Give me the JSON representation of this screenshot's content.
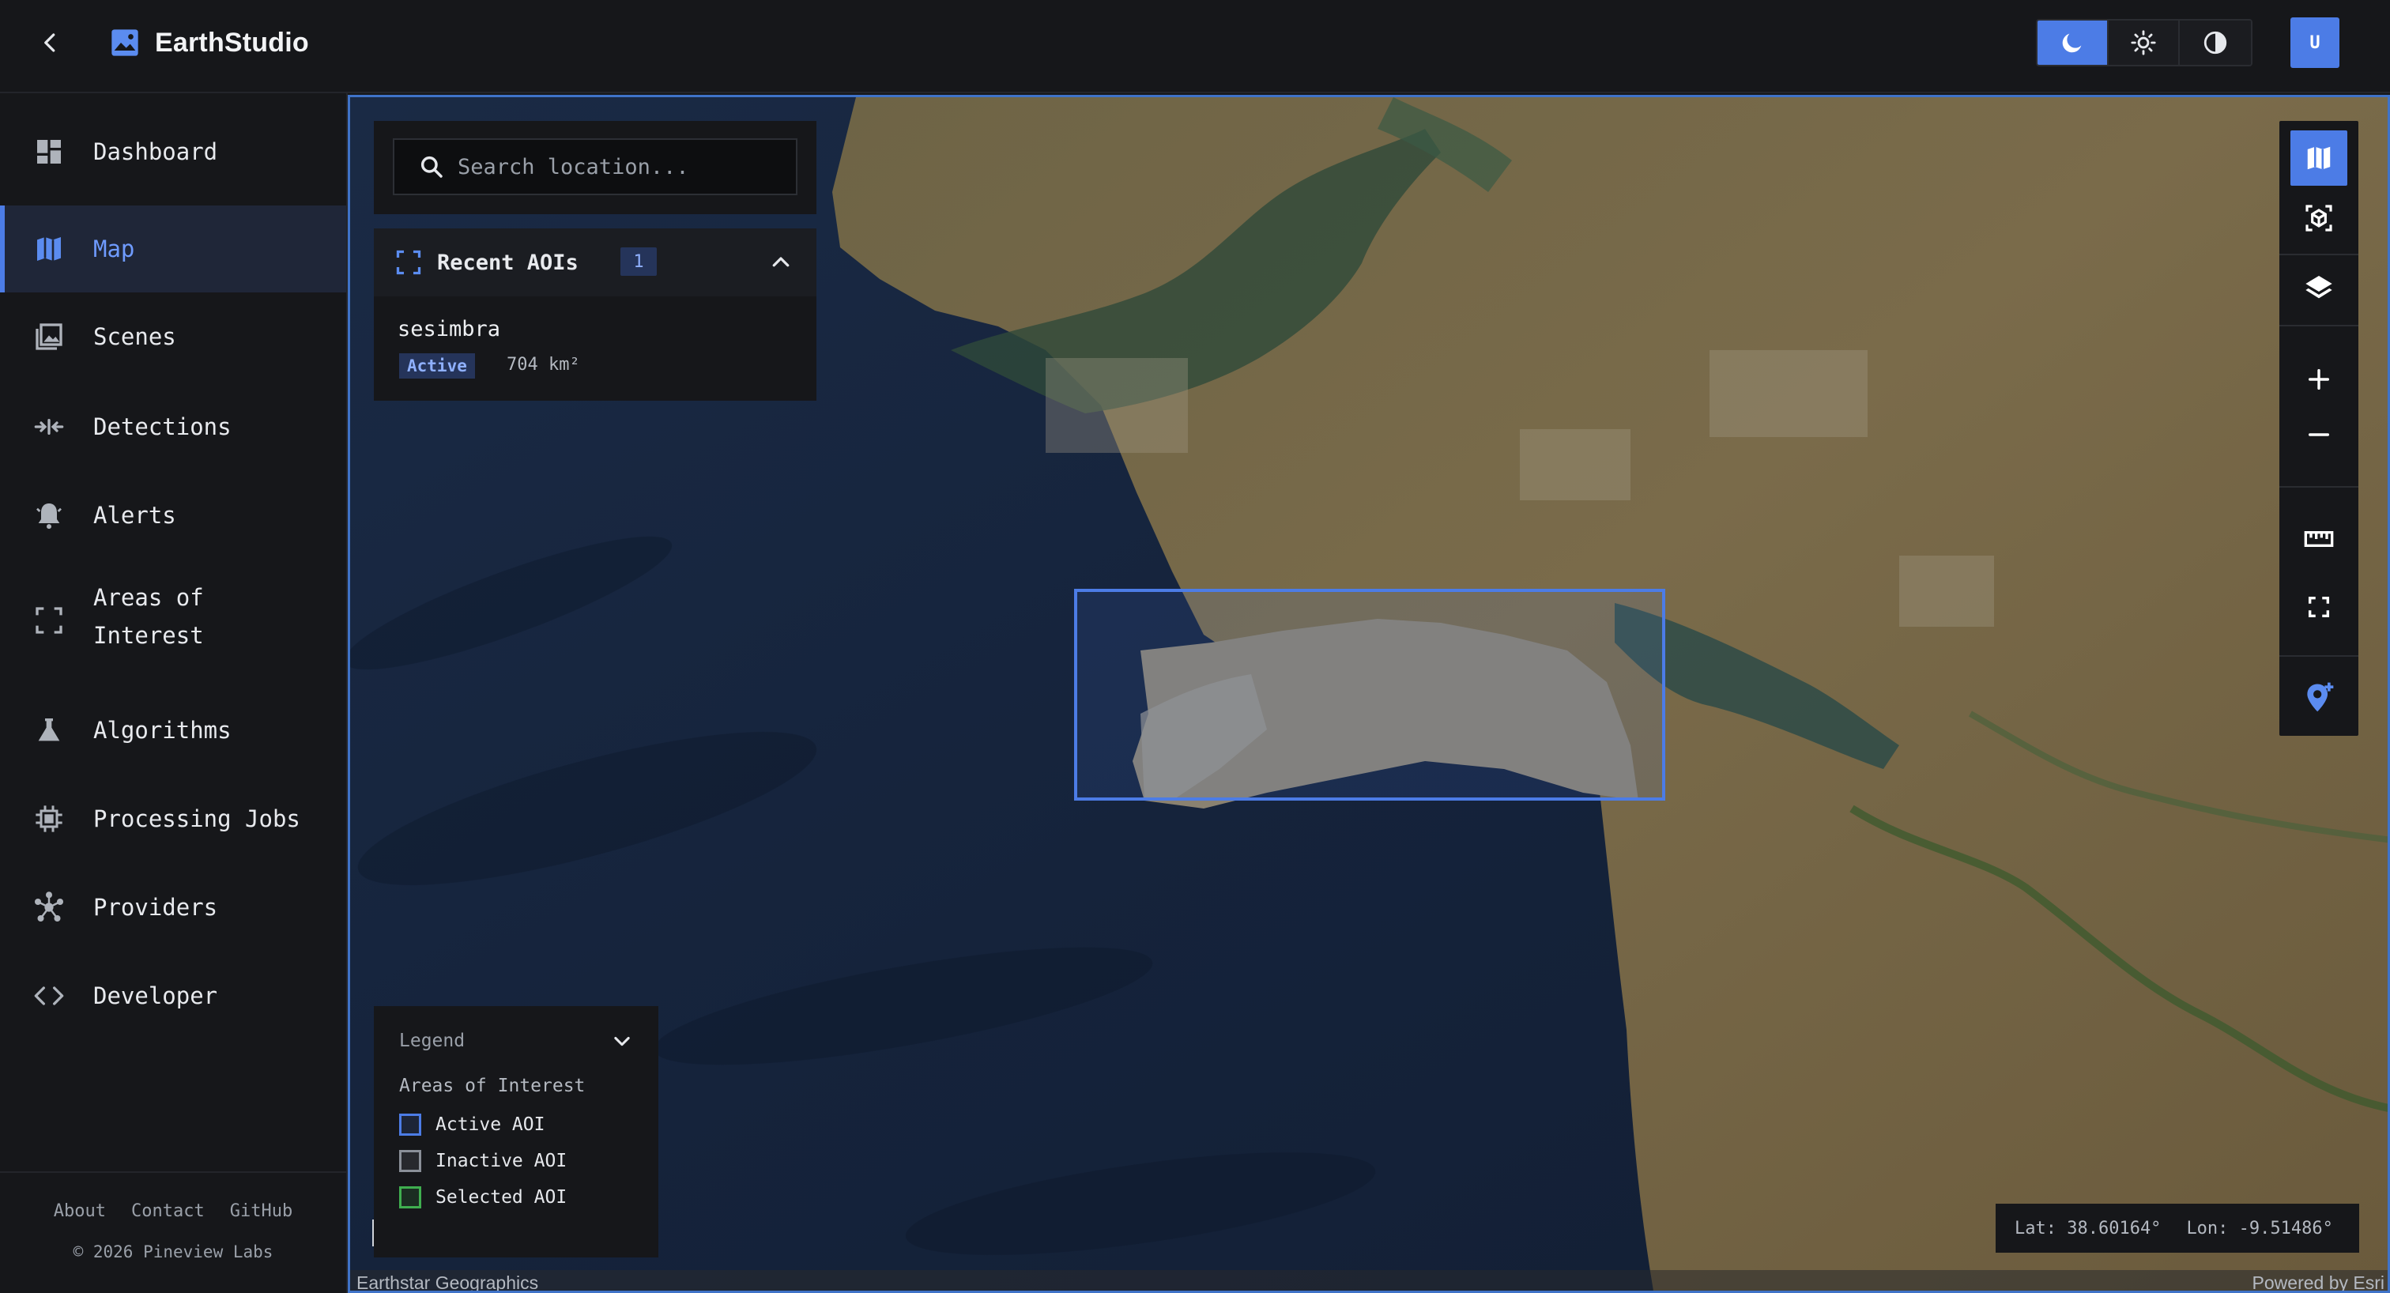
{
  "app": {
    "name": "EarthStudio"
  },
  "header": {
    "back_label": "Back",
    "theme_modes": [
      {
        "name": "dark",
        "icon": "moon-icon",
        "active": true
      },
      {
        "name": "light",
        "icon": "sun-icon",
        "active": false
      },
      {
        "name": "contrast",
        "icon": "contrast-icon",
        "active": false
      }
    ],
    "user_initial": "U"
  },
  "sidebar": {
    "items": [
      {
        "label": "Dashboard",
        "icon": "dashboard-icon",
        "active": false
      },
      {
        "label": "Map",
        "icon": "map-icon",
        "active": true
      },
      {
        "label": "Scenes",
        "icon": "scenes-icon",
        "active": false
      },
      {
        "label": "Detections",
        "icon": "detections-icon",
        "active": false
      },
      {
        "label": "Alerts",
        "icon": "alerts-icon",
        "active": false
      },
      {
        "label": "Areas of",
        "label2": "Interest",
        "icon": "aoi-icon",
        "active": false
      },
      {
        "label": "Algorithms",
        "icon": "algorithms-icon",
        "active": false
      },
      {
        "label": "Processing Jobs",
        "icon": "processing-icon",
        "active": false
      },
      {
        "label": "Providers",
        "icon": "providers-icon",
        "active": false
      },
      {
        "label": "Developer",
        "icon": "code-icon",
        "active": false
      }
    ],
    "footer": {
      "links": [
        "About",
        "Contact",
        "GitHub"
      ],
      "copyright": "© 2026 Pineview Labs"
    }
  },
  "map": {
    "search": {
      "placeholder": "Search location..."
    },
    "recent_aois": {
      "title": "Recent AOIs",
      "count": "1",
      "items": [
        {
          "name": "sesimbra",
          "status": "Active",
          "area": "704 km²"
        }
      ]
    },
    "legend": {
      "title": "Legend",
      "section": "Areas of Interest",
      "entries": [
        {
          "label": "Active AOI",
          "color": "#4c7ce6"
        },
        {
          "label": "Inactive AOI",
          "color": "#8a8f98"
        },
        {
          "label": "Selected AOI",
          "color": "#3fae4f"
        }
      ]
    },
    "coords": {
      "lat": "Lat: 38.60164°",
      "lon": "Lon: -9.51486°"
    },
    "attribution": {
      "left": "Earthstar Geographics",
      "right": "Powered by Esri"
    },
    "tools": [
      "map-view-icon",
      "3d-view-icon",
      "layers-icon",
      "zoom-in-icon",
      "zoom-out-icon",
      "measure-icon",
      "fullscreen-icon",
      "add-location-icon"
    ]
  },
  "colors": {
    "accent": "#4c7ce6",
    "background": "#16171a",
    "ocean": "#16243d",
    "land": "#6b5e40"
  }
}
